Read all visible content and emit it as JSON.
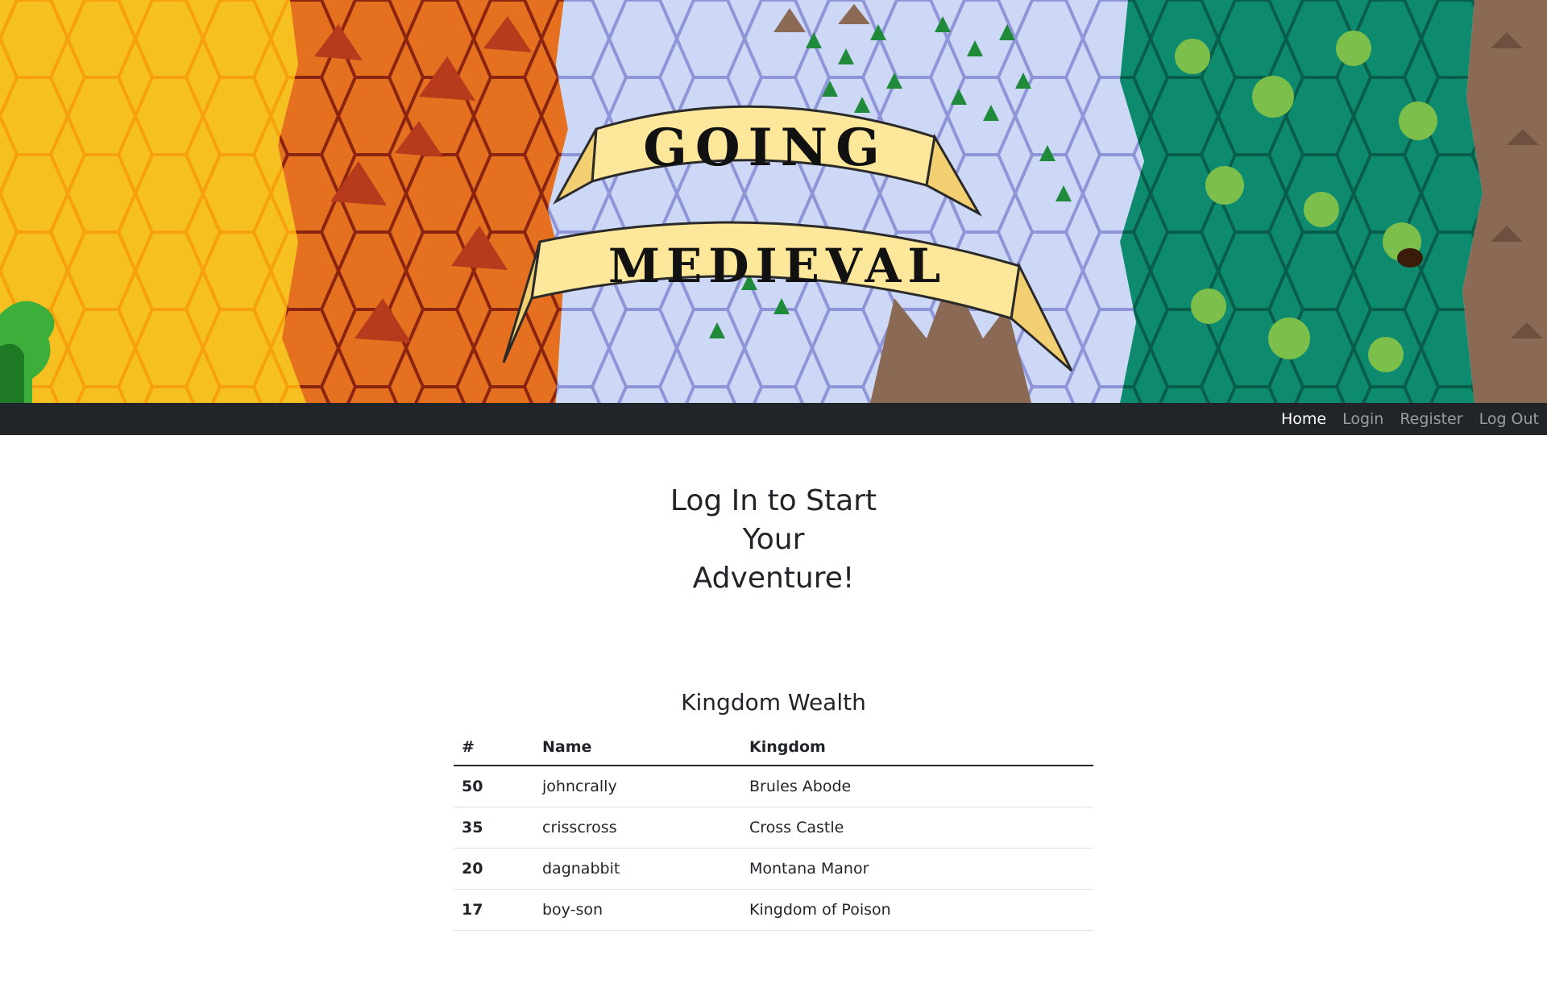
{
  "banner": {
    "logo_alt": "Going Medieval",
    "logo_line1": "GOING",
    "logo_line2": "MEDIEVAL"
  },
  "navbar": {
    "items": [
      {
        "label": "Home",
        "active": true
      },
      {
        "label": "Login",
        "active": false
      },
      {
        "label": "Register",
        "active": false
      },
      {
        "label": "Log Out",
        "active": false
      }
    ]
  },
  "hero": {
    "title_line1": "Log In to Start",
    "title_line2": "Your",
    "title_line3": "Adventure!"
  },
  "wealth_table": {
    "title": "Kingdom Wealth",
    "headers": [
      "#",
      "Name",
      "Kingdom"
    ],
    "rows": [
      {
        "rank": "50",
        "name": "johncrally",
        "kingdom": "Brules Abode"
      },
      {
        "rank": "35",
        "name": "crisscross",
        "kingdom": "Cross Castle"
      },
      {
        "rank": "20",
        "name": "dagnabbit",
        "kingdom": "Montana Manor"
      },
      {
        "rank": "17",
        "name": "boy-son",
        "kingdom": "Kingdom of Poison"
      }
    ]
  },
  "colors": {
    "navbar_bg": "#212529",
    "nav_active": "#ffffff",
    "nav_inactive": "#8f9194",
    "text": "#212529",
    "desert": "#f5c020",
    "lava": "#d9661e",
    "snow": "#c9d6f5",
    "forest": "#0e8a6e",
    "rock": "#8a6a55",
    "scroll": "#fde79a"
  }
}
